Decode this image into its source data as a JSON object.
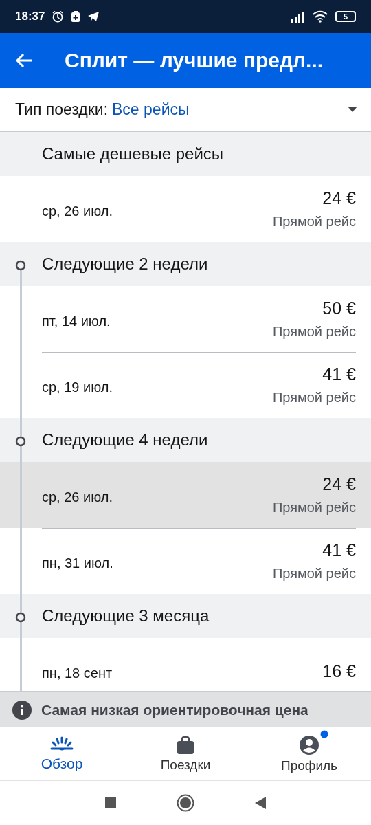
{
  "status_bar": {
    "time": "18:37",
    "battery": "5"
  },
  "app_bar": {
    "title": "Сплит — лучшие предл..."
  },
  "filter": {
    "label": "Тип поездки:",
    "value": "Все рейсы"
  },
  "sections": [
    {
      "title": "Самые дешевые рейсы",
      "timeline": false,
      "rows": [
        {
          "date": "ср, 26 июл.",
          "price": "24 €",
          "type": "Прямой рейс",
          "selected": false
        }
      ]
    },
    {
      "title": "Следующие 2 недели",
      "timeline": true,
      "rows": [
        {
          "date": "пт, 14 июл.",
          "price": "50 €",
          "type": "Прямой рейс",
          "selected": false
        },
        {
          "date": "ср, 19 июл.",
          "price": "41 €",
          "type": "Прямой рейс",
          "selected": false
        }
      ]
    },
    {
      "title": "Следующие 4 недели",
      "timeline": true,
      "rows": [
        {
          "date": "ср, 26 июл.",
          "price": "24 €",
          "type": "Прямой рейс",
          "selected": true
        },
        {
          "date": "пн, 31 июл.",
          "price": "41 €",
          "type": "Прямой рейс",
          "selected": false
        }
      ]
    },
    {
      "title": "Следующие 3 месяца",
      "timeline": true,
      "rows": [
        {
          "date": "пн, 18 сент",
          "price": "16 €",
          "selected": false
        }
      ]
    }
  ],
  "banner": {
    "text": "Самая низкая ориентировочная цена"
  },
  "nav": [
    {
      "label": "Обзор",
      "selected": true,
      "kind": "overview"
    },
    {
      "label": "Поездки",
      "selected": false,
      "kind": "trips"
    },
    {
      "label": "Профиль",
      "selected": false,
      "kind": "profile",
      "dot": true
    }
  ]
}
